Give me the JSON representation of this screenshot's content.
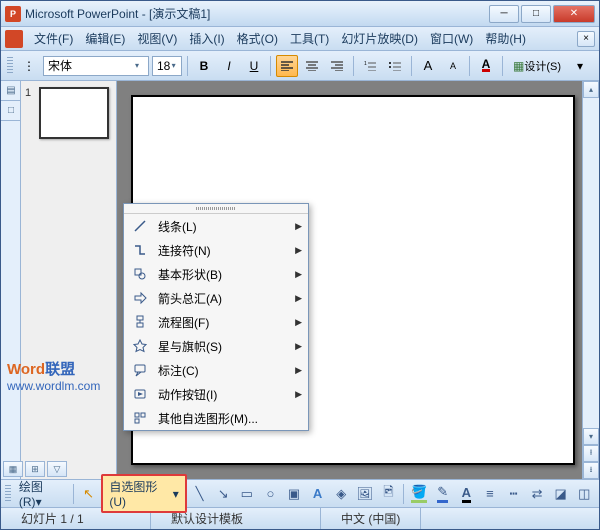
{
  "titlebar": {
    "appName": "Microsoft PowerPoint",
    "docName": "[演示文稿1]"
  },
  "menubar": {
    "file": "文件(F)",
    "edit": "编辑(E)",
    "view": "视图(V)",
    "insert": "插入(I)",
    "format": "格式(O)",
    "tools": "工具(T)",
    "slideshow": "幻灯片放映(D)",
    "window": "窗口(W)",
    "help": "帮助(H)"
  },
  "format_toolbar": {
    "fontName": "宋体",
    "fontSize": "18",
    "design": "设计(S)"
  },
  "slides": {
    "current": "1"
  },
  "watermark": {
    "line1a": "Word",
    "line1b": "联盟",
    "line2": "www.wordlm.com"
  },
  "autoshape_menu": {
    "lines": "线条(L)",
    "connectors": "连接符(N)",
    "basic": "基本形状(B)",
    "arrows": "箭头总汇(A)",
    "flowchart": "流程图(F)",
    "stars": "星与旗帜(S)",
    "callouts": "标注(C)",
    "actions": "动作按钮(I)",
    "more": "其他自选图形(M)..."
  },
  "drawing_toolbar": {
    "draw": "绘图(R)",
    "autoshapes": "自选图形(U)"
  },
  "statusbar": {
    "slideInfo": "幻灯片 1 / 1",
    "template": "默认设计模板",
    "language": "中文 (中国)"
  }
}
